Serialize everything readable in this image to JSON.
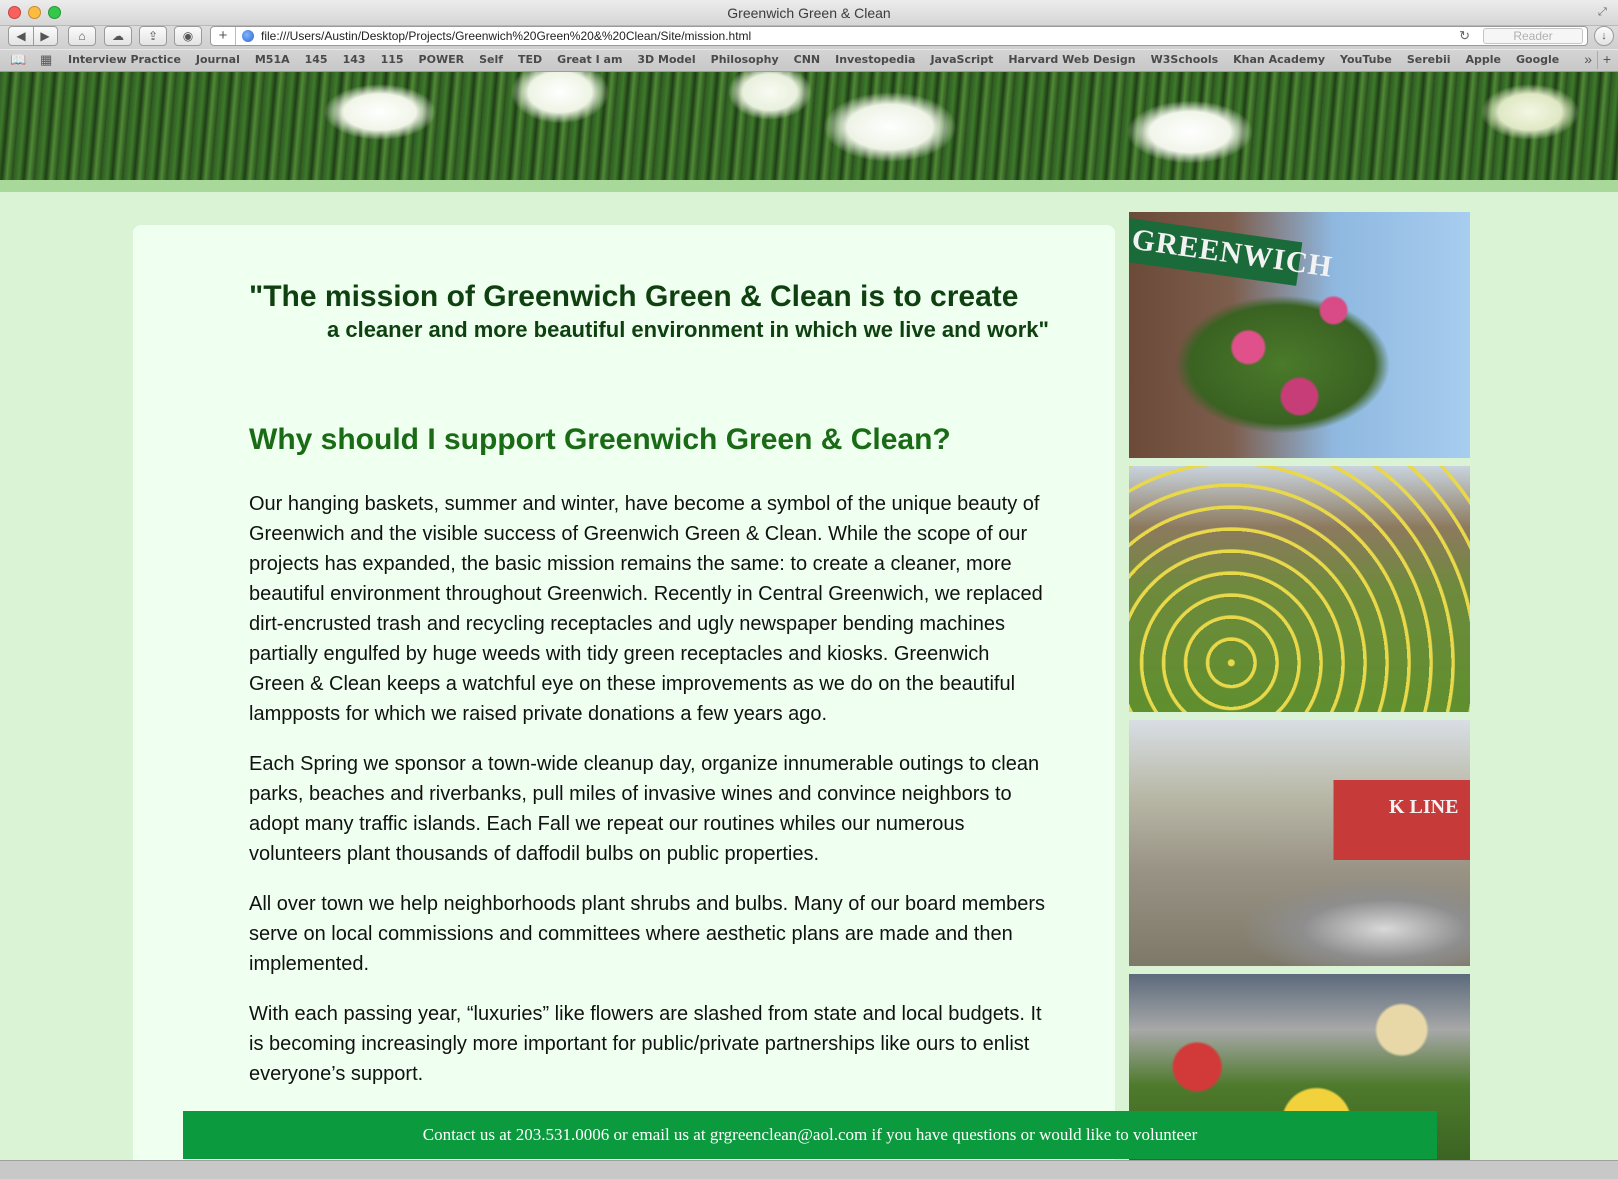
{
  "window": {
    "title": "Greenwich Green & Clean",
    "url": "file:///Users/Austin/Desktop/Projects/Greenwich%20Green%20&%20Clean/Site/mission.html",
    "reader_label": "Reader"
  },
  "toolbar": {
    "back_icon": "◀",
    "forward_icon": "▶",
    "home_icon": "⌂",
    "cloud_icon": "☁",
    "share_icon": "⇪",
    "stop_icon": "◉",
    "add_icon": "+",
    "reload_icon": "↻",
    "download_icon": "↓"
  },
  "bookmarks": {
    "items": [
      "Interview Practice",
      "Journal",
      "M51A",
      "145",
      "143",
      "115",
      "POWER",
      "Self",
      "TED",
      "Great I am",
      "3D Model",
      "Philosophy",
      "CNN",
      "Investopedia",
      "JavaScript",
      "Harvard Web Design",
      "W3Schools",
      "Khan Academy",
      "YouTube",
      "Serebii",
      "Apple",
      "Google"
    ],
    "more_icon": "»",
    "add_icon": "+"
  },
  "mission": {
    "line1": "\"The mission of Greenwich Green & Clean is to create",
    "line2": "a cleaner and more beautiful environment in which we live and work\""
  },
  "heading": "Why should I support Greenwich Green & Clean?",
  "paragraphs": [
    "Our hanging baskets, summer and winter, have become a symbol of the unique beauty of Greenwich and the visible success of Greenwich Green & Clean. While the scope of our projects has expanded, the basic mission remains the same: to create a cleaner, more beautiful environment throughout Greenwich. Recently in Central Greenwich, we replaced dirt-encrusted trash and recycling receptacles and ugly newspaper bending machines partially engulfed by huge weeds with tidy green receptacles and kiosks. Greenwich Green & Clean keeps a watchful eye on these improvements as we do on the beautiful lampposts for which we raised private donations a few years ago.",
    "Each Spring we sponsor a town-wide cleanup day, organize innumerable outings to clean parks, beaches and riverbanks, pull miles of invasive wines and convince neighbors to adopt many traffic islands. Each Fall we repeat our routines whiles our numerous volunteers plant thousands of daffodil bulbs on public properties.",
    "All over town we help neighborhoods plant shrubs and bulbs. Many of our board members serve on local commissions and committees where aesthetic plans are made and then implemented.",
    "With each passing year, “luxuries” like flowers are slashed from state and local budgets. It is becoming increasingly more important for public/private partnerships like ours to enlist everyone’s support."
  ],
  "photos": {
    "sign_text": "GREENWICH",
    "container_text": "K LINE"
  },
  "footer": {
    "text": "Contact us at 203.531.0006 or email us at grgreenclean@aol.com if you have questions or would like to volunteer"
  },
  "colors": {
    "page_bg": "#d9f3d4",
    "content_bg": "#effff0",
    "mission_text": "#0e4010",
    "heading_text": "#1a6b15",
    "footer_bg": "#0c9a3e"
  }
}
